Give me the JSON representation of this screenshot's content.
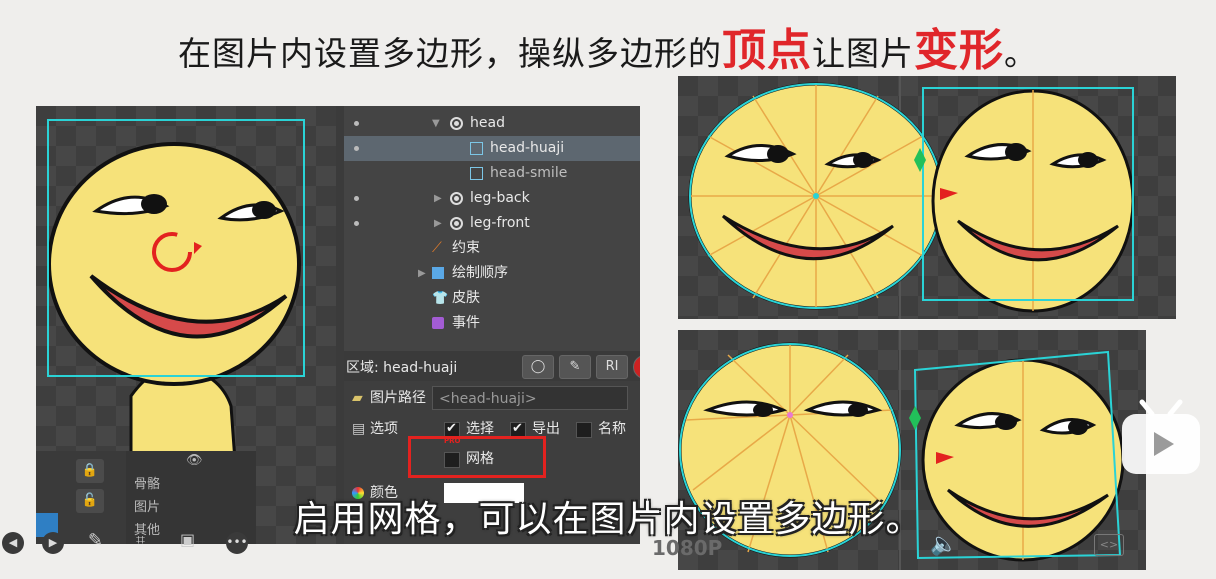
{
  "headline": {
    "part1": "在图片内设置多边形，操纵多边形的",
    "hl1": "顶点",
    "part2": "让图片",
    "hl2": "变形",
    "part3": "。"
  },
  "tree": {
    "items": [
      {
        "label": "head",
        "kind": "bone"
      },
      {
        "label": "head-huaji",
        "kind": "attachment",
        "selected": true
      },
      {
        "label": "head-smile",
        "kind": "attachment"
      },
      {
        "label": "leg-back",
        "kind": "bone"
      },
      {
        "label": "leg-front",
        "kind": "bone"
      },
      {
        "label": "约束",
        "kind": "constraint"
      },
      {
        "label": "绘制顺序",
        "kind": "draworder"
      },
      {
        "label": "皮肤",
        "kind": "skin"
      },
      {
        "label": "事件",
        "kind": "event"
      }
    ]
  },
  "region": {
    "label": "区域: head-huaji",
    "btn_ri": "RI"
  },
  "props": {
    "path_label": "图片路径",
    "path_value": "<head-huaji>",
    "options_label": "选项",
    "select_label": "选择",
    "export_label": "导出",
    "name_label": "名称",
    "mesh_label": "网格",
    "pro_badge": "PRO",
    "color_label": "颜色"
  },
  "layers": {
    "bones": "骨骼",
    "images": "图片",
    "others": "其他"
  },
  "player": {
    "quality": "1080P"
  },
  "subtitle": "启用网格，可以在图片内设置多边形。",
  "colors": {
    "accent_red": "#e0262a",
    "face_yellow": "#f6e27a",
    "mesh_cyan": "#2ad3d6"
  }
}
